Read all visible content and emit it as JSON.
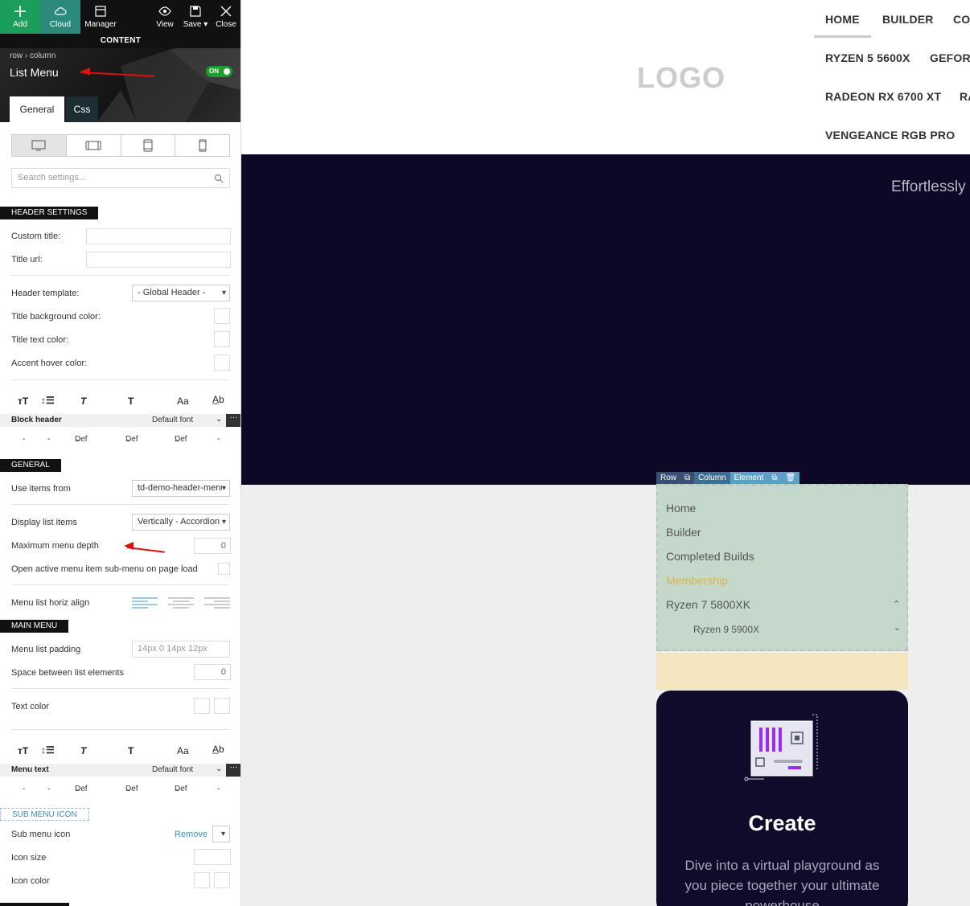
{
  "toolbar": {
    "add": "Add",
    "cloud": "Cloud",
    "manager": "Manager",
    "view": "View",
    "save": "Save",
    "close": "Close",
    "content": "CONTENT"
  },
  "panel_header": {
    "breadcrumb_row": "row",
    "breadcrumb_column": "column",
    "title": "List Menu",
    "toggle": "ON",
    "tab_general": "General",
    "tab_css": "Css"
  },
  "search": {
    "placeholder": "Search settings..."
  },
  "header_settings": {
    "title": "HEADER SETTINGS",
    "custom_title": "Custom title:",
    "title_url": "Title url:",
    "header_template": "Header template:",
    "header_template_value": "- Global Header -",
    "title_bg_color": "Title background color:",
    "title_text_color": "Title text color:",
    "accent_hover_color": "Accent hover color:"
  },
  "block_header_font": {
    "label": "Block header",
    "font": "Default font",
    "dash1": "-",
    "dash2": "-",
    "def1": "Def",
    "def2": "Def",
    "def3": "Def",
    "dash3": "-"
  },
  "general": {
    "title": "GENERAL",
    "use_items_from": "Use items from",
    "use_items_value": "td-demo-header-menu",
    "display_list_items": "Display list items",
    "display_value": "Vertically - Accordion",
    "max_menu_depth": "Maximum menu depth",
    "max_menu_depth_value": "0",
    "open_active": "Open active menu item sub-menu on page load",
    "horiz_align": "Menu list horiz align"
  },
  "main_menu": {
    "title": "MAIN MENU",
    "padding": "Menu list padding",
    "padding_value": "14px 0 14px 12px",
    "space_between": "Space between list elements",
    "space_value": "0",
    "text_color": "Text color"
  },
  "menu_text_font": {
    "label": "Menu text",
    "font": "Default font",
    "dash1": "-",
    "dash2": "-",
    "def1": "Def",
    "def2": "Def",
    "def3": "Def",
    "dash3": "-"
  },
  "sub_menu_icon": {
    "title": "SUB MENU ICON",
    "label": "Sub menu icon",
    "remove": "Remove",
    "icon_size": "Icon size",
    "icon_color": "Icon color"
  },
  "site": {
    "logo": "LOGO",
    "nav_home": "HOME",
    "nav_builder": "BUILDER",
    "nav_co": "CO",
    "nav_ryzen5": "RYZEN 5 5600X",
    "nav_gefor": "GEFORC",
    "nav_radeon": "RADEON RX 6700 XT",
    "nav_ra": "RA",
    "nav_vengeance": "VENGEANCE RGB PRO",
    "hero_text": "Effortlessly",
    "el_row": "Row",
    "el_column": "Column",
    "el_element": "Element",
    "menu_items": [
      "Home",
      "Builder",
      "Completed Builds",
      "Membership",
      "Ryzen 7 5800XK"
    ],
    "submenu_item": "Ryzen 9 5900X",
    "card_title": "Create",
    "card_text": "Dive into a virtual playground as you piece together your ultimate powerhouse"
  },
  "colors": {
    "accent_green": "#1a9e2c",
    "hero_bg": "#0c0826",
    "menu_bg": "#c4d8cc",
    "membership_gold": "#d9b54a",
    "card_purple": "#9b2cf0"
  }
}
